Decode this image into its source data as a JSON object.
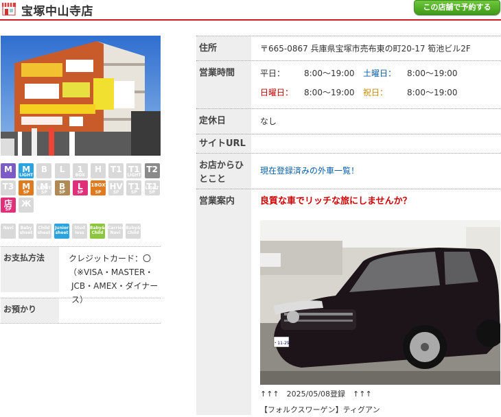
{
  "header": {
    "title": "宝塚中山寺店",
    "reserve_button": "この店舗で予約する"
  },
  "badges": [
    {
      "label": "M",
      "sub": "",
      "color": "#7c5cc4"
    },
    {
      "label": "M",
      "sub": "LIGHT",
      "color": "#2aa3e0"
    },
    {
      "label": "B",
      "sub": "",
      "color": "#d9d9d9"
    },
    {
      "label": "L",
      "sub": "",
      "color": "#d9d9d9"
    },
    {
      "label": "1",
      "sub": "BOX",
      "color": "#d9d9d9"
    },
    {
      "label": "H",
      "sub": "",
      "color": "#d9d9d9"
    },
    {
      "label": "T1",
      "sub": "",
      "color": "#d9d9d9"
    },
    {
      "label": "T1",
      "sub": "LIGHT",
      "color": "#d9d9d9"
    },
    {
      "label": "T2",
      "sub": "",
      "color": "#8a8a8a"
    },
    {
      "label": "T3",
      "sub": "",
      "color": "#d9d9d9"
    },
    {
      "label": "M",
      "sub": "SP",
      "color": "#e07a1e"
    },
    {
      "label": "M",
      "sub": "LIGHT SP",
      "color": "#d9d9d9"
    },
    {
      "label": "B",
      "sub": "SP",
      "color": "#b08a56"
    },
    {
      "label": "L",
      "sub": "SP",
      "color": "#e0307a"
    },
    {
      "label": "1BOX",
      "sub": "SP",
      "color": "#e07a1e"
    },
    {
      "label": "HV",
      "sub": "SP",
      "color": "#d9d9d9"
    },
    {
      "label": "T1",
      "sub": "SP",
      "color": "#d9d9d9"
    },
    {
      "label": "T1",
      "sub": "LIGHT SP",
      "color": "#d9d9d9"
    },
    {
      "label": "店",
      "sub": "SP",
      "color": "#e0307a"
    },
    {
      "label": "Ж",
      "sub": "",
      "color": "#d9d9d9"
    }
  ],
  "option_icons": [
    {
      "label": "Navi",
      "color": "#d9d9d9"
    },
    {
      "label": "Baby sheet",
      "color": "#d9d9d9"
    },
    {
      "label": "Child sheet",
      "color": "#d9d9d9"
    },
    {
      "label": "Junior sheet",
      "color": "#2aa3e0"
    },
    {
      "label": "Stud less",
      "color": "#d9d9d9"
    },
    {
      "label": "Baby& Child",
      "color": "#8cc63f"
    },
    {
      "label": "Carrier Navi",
      "color": "#d9d9d9"
    },
    {
      "label": "Baby& Child",
      "color": "#d9d9d9"
    }
  ],
  "payment": {
    "label": "お支払方法",
    "value_line1": "クレジットカード：〇",
    "value_line2": "（※VISA・MASTER・",
    "value_line3": "JCB・AMEX・ダイナース）"
  },
  "deposit": {
    "label": "お預かり",
    "value": ""
  },
  "info": {
    "address_label": "住所",
    "address_value": "〒665-0867 兵庫県宝塚市売布東の町20-17 筍池ビル2F",
    "hours_label": "営業時間",
    "weekday_label": "平日：",
    "weekday_hours": "8:00～19:00",
    "saturday_label": "土曜日：",
    "saturday_hours": "8:00～19:00",
    "sunday_label": "日曜日：",
    "sunday_hours": "8:00～19:00",
    "holiday_label": "祝日：",
    "holiday_hours": "8:00～19:00",
    "closed_label": "定休日",
    "closed_value": "なし",
    "site_label": "サイトURL",
    "site_value": "",
    "message_label_1": "お店からひ",
    "message_label_2": "とこと",
    "message_link": "現在登録済みの外車一覧！",
    "guide_label": "営業案内",
    "guide_headline": "良質な車でリッチな旅にしませんか？",
    "car_plate": "・11-29",
    "caption_line1": "↑↑↑　2025/05/08登録　↑↑↑",
    "caption_line2": "【フォルクスワーゲン】ティグアン"
  }
}
